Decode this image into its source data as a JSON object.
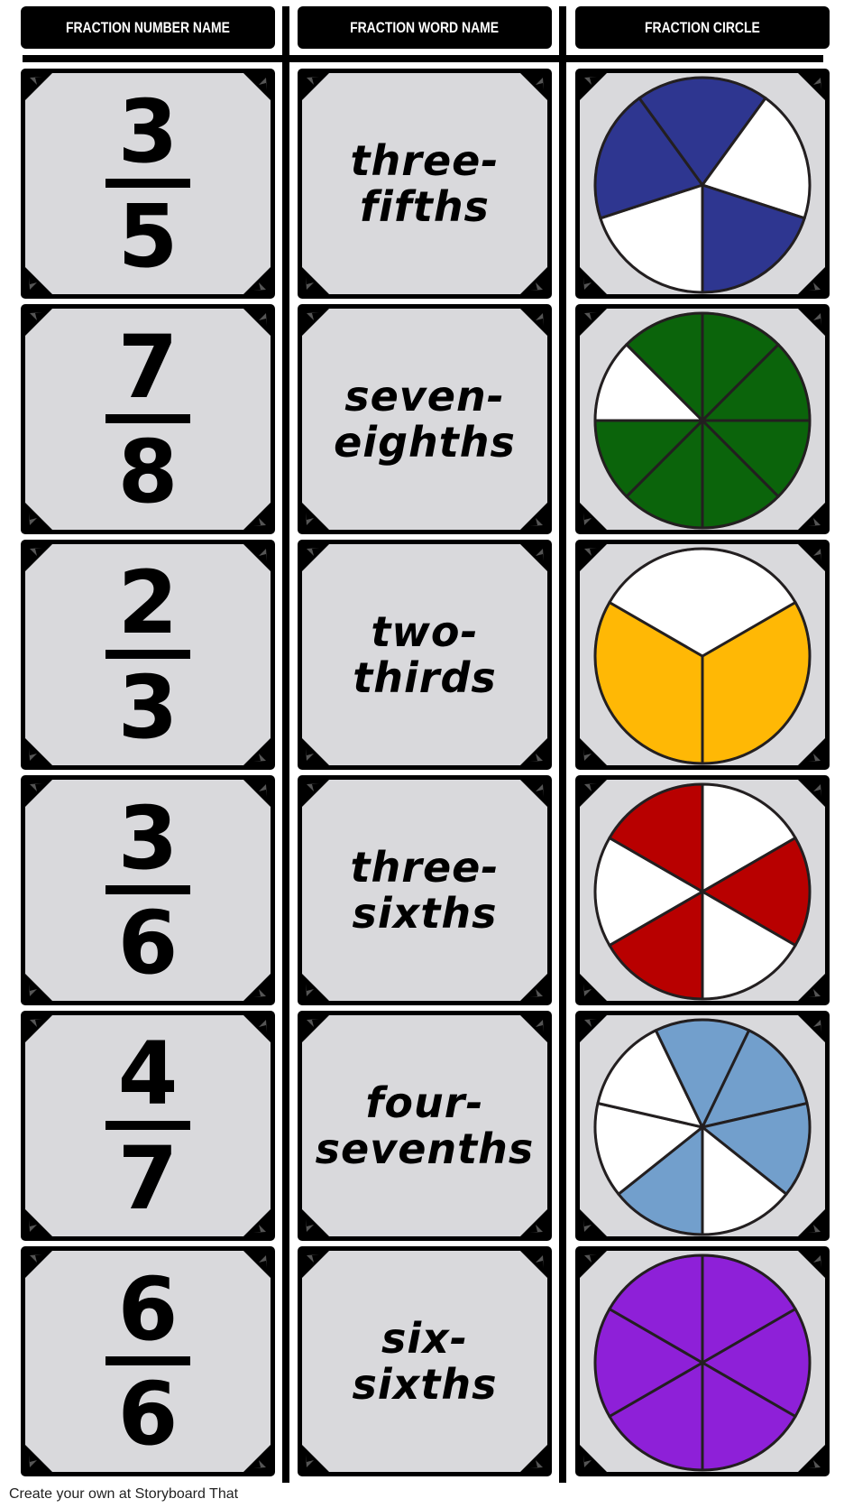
{
  "headers": {
    "number": "FRACTION NUMBER NAME",
    "word": "FRACTION WORD NAME",
    "circle": "FRACTION CIRCLE"
  },
  "rows": [
    {
      "numerator": "3",
      "denominator": "5",
      "word_line1": "three-",
      "word_line2": "fifths",
      "circle": {
        "slices": 5,
        "start_deg": 180,
        "filled": [
          false,
          true,
          true,
          false,
          true
        ],
        "fill_color": "#2e3690"
      }
    },
    {
      "numerator": "7",
      "denominator": "8",
      "word_line1": "seven-",
      "word_line2": "eighths",
      "circle": {
        "slices": 8,
        "start_deg": 0,
        "filled": [
          true,
          true,
          true,
          true,
          true,
          true,
          false,
          true
        ],
        "fill_color": "#0b640b"
      }
    },
    {
      "numerator": "2",
      "denominator": "3",
      "word_line1": "two-",
      "word_line2": "thirds",
      "circle": {
        "slices": 3,
        "start_deg": 60,
        "filled": [
          true,
          true,
          false
        ],
        "fill_color": "#ffb805"
      }
    },
    {
      "numerator": "3",
      "denominator": "6",
      "word_line1": "three-",
      "word_line2": "sixths",
      "circle": {
        "slices": 6,
        "start_deg": 0,
        "filled": [
          false,
          true,
          false,
          true,
          false,
          true
        ],
        "fill_color": "#b80000"
      }
    },
    {
      "numerator": "4",
      "denominator": "7",
      "word_line1": "four-",
      "word_line2": "sevenths",
      "circle": {
        "slices": 7,
        "start_deg": 180,
        "filled": [
          true,
          false,
          false,
          true,
          true,
          true,
          false
        ],
        "fill_color": "#729fcc"
      }
    },
    {
      "numerator": "6",
      "denominator": "6",
      "word_line1": "six-",
      "word_line2": "sixths",
      "circle": {
        "slices": 6,
        "start_deg": 0,
        "filled": [
          true,
          true,
          true,
          true,
          true,
          true
        ],
        "fill_color": "#8e20d8"
      }
    }
  ],
  "footer": "Create your own at Storyboard That"
}
